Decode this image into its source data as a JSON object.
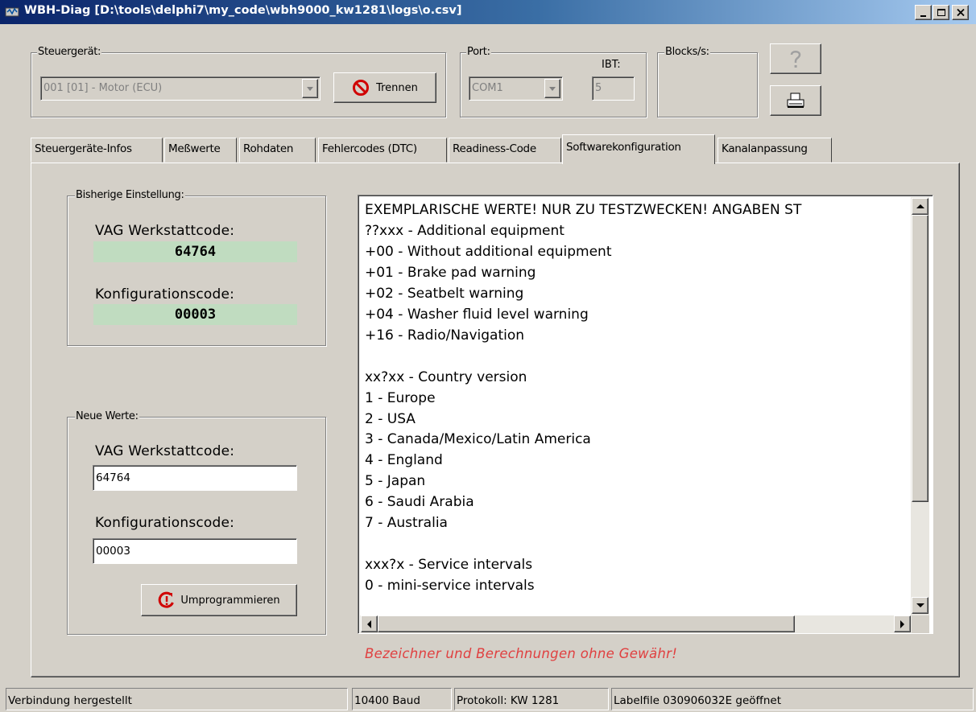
{
  "window": {
    "title": "WBH-Diag [D:\\tools\\delphi7\\my_code\\wbh9000_kw1281\\logs\\o.csv]"
  },
  "header": {
    "steuergeraet_label": "Steuergerät:",
    "steuergeraet_value": "001 [01] - Motor (ECU)",
    "trennen_label": "Trennen",
    "port_label": "Port:",
    "port_value": "COM1",
    "ibt_label": "IBT:",
    "ibt_value": "5",
    "blocks_label": "Blocks/s:"
  },
  "tabs": [
    "Steuergeräte-Infos",
    "Meßwerte",
    "Rohdaten",
    "Fehlercodes (DTC)",
    "Readiness-Code",
    "Softwarekonfiguration",
    "Kanalanpassung"
  ],
  "active_tab": "Softwarekonfiguration",
  "previous": {
    "group_label": "Bisherige Einstellung:",
    "workshop_label": "VAG Werkstattcode:",
    "workshop_value": "64764",
    "config_label": "Konfigurationscode:",
    "config_value": "00003"
  },
  "new_values": {
    "group_label": "Neue Werte:",
    "workshop_label": "VAG Werkstattcode:",
    "workshop_value": "64764",
    "config_label": "Konfigurationscode:",
    "config_value": "00003",
    "program_button": "Umprogrammieren"
  },
  "memo_lines": [
    "EXEMPLARISCHE WERTE! NUR ZU TESTZWECKEN! ANGABEN ST",
    "??xxx - Additional equipment",
    "+00 - Without additional equipment",
    "+01 - Brake pad warning",
    "+02 - Seatbelt warning",
    "+04 - Washer fluid level warning",
    "+16 - Radio/Navigation",
    "",
    "xx?xx - Country version",
    "1 - Europe",
    "2 - USA",
    "3 - Canada/Mexico/Latin America",
    "4 - England",
    "5 - Japan",
    "6 - Saudi Arabia",
    "7 - Australia",
    "",
    "xxx?x - Service intervals",
    "0 - mini-service intervals"
  ],
  "disclaimer": "Bezeichner und Berechnungen ohne Gewähr!",
  "status": {
    "connection": "Verbindung hergestellt",
    "baud": "10400 Baud",
    "protocol": "Protokoll: KW 1281",
    "labelfile": "Labelfile 030906032E geöffnet"
  },
  "icons": {
    "app": "wbh-diag-app-icon",
    "trennen": "no-entry-icon",
    "help": "question-mark-icon",
    "print": "printer-icon",
    "program": "reprogram-icon"
  }
}
